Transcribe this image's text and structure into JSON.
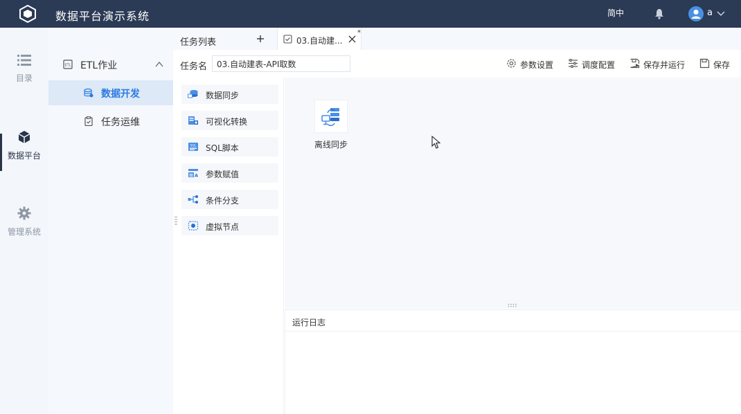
{
  "header": {
    "app_title": "数据平台演示系统",
    "language": "简中",
    "username": "a",
    "icons": [
      "logo-icon",
      "bell-icon",
      "user-icon",
      "chevron-down-icon"
    ]
  },
  "rail": {
    "items": [
      {
        "label": "目录",
        "icon": "list-icon",
        "active": false
      },
      {
        "label": "数据平台",
        "icon": "cube-icon",
        "active": true
      },
      {
        "label": "管理系统",
        "icon": "gear-icon",
        "active": false
      }
    ]
  },
  "sidebar": {
    "group": {
      "label": "ETL作业",
      "icon": "etl-icon",
      "expanded": true
    },
    "items": [
      {
        "label": "数据开发",
        "icon": "database-icon",
        "active": true
      },
      {
        "label": "任务运维",
        "icon": "clipboard-icon",
        "active": false
      }
    ]
  },
  "tabs": {
    "list_label": "任务列表",
    "active_tab": {
      "label": "03.自动建...",
      "modified_marker": "*"
    }
  },
  "task": {
    "name_label": "任务名",
    "name_value": "03.自动建表-API取数",
    "toolbar": {
      "params": "参数设置",
      "schedule": "调度配置",
      "save_run": "保存并运行",
      "save": "保存"
    }
  },
  "palette": {
    "items": [
      {
        "label": "数据同步",
        "icon": "data-sync-icon"
      },
      {
        "label": "可视化转换",
        "icon": "visual-transform-icon"
      },
      {
        "label": "SQL脚本",
        "icon": "sql-icon"
      },
      {
        "label": "参数赋值",
        "icon": "param-assign-icon"
      },
      {
        "label": "条件分支",
        "icon": "branch-icon"
      },
      {
        "label": "虚拟节点",
        "icon": "virtual-node-icon"
      }
    ]
  },
  "canvas": {
    "nodes": [
      {
        "label": "离线同步",
        "icon": "offline-sync-icon"
      }
    ]
  },
  "log": {
    "title": "运行日志"
  },
  "colors": {
    "header_bg": "#2b3a55",
    "accent": "#2a7be0",
    "sidebar_active_bg": "#dde9f7",
    "canvas_bg": "#f6f8fb"
  }
}
